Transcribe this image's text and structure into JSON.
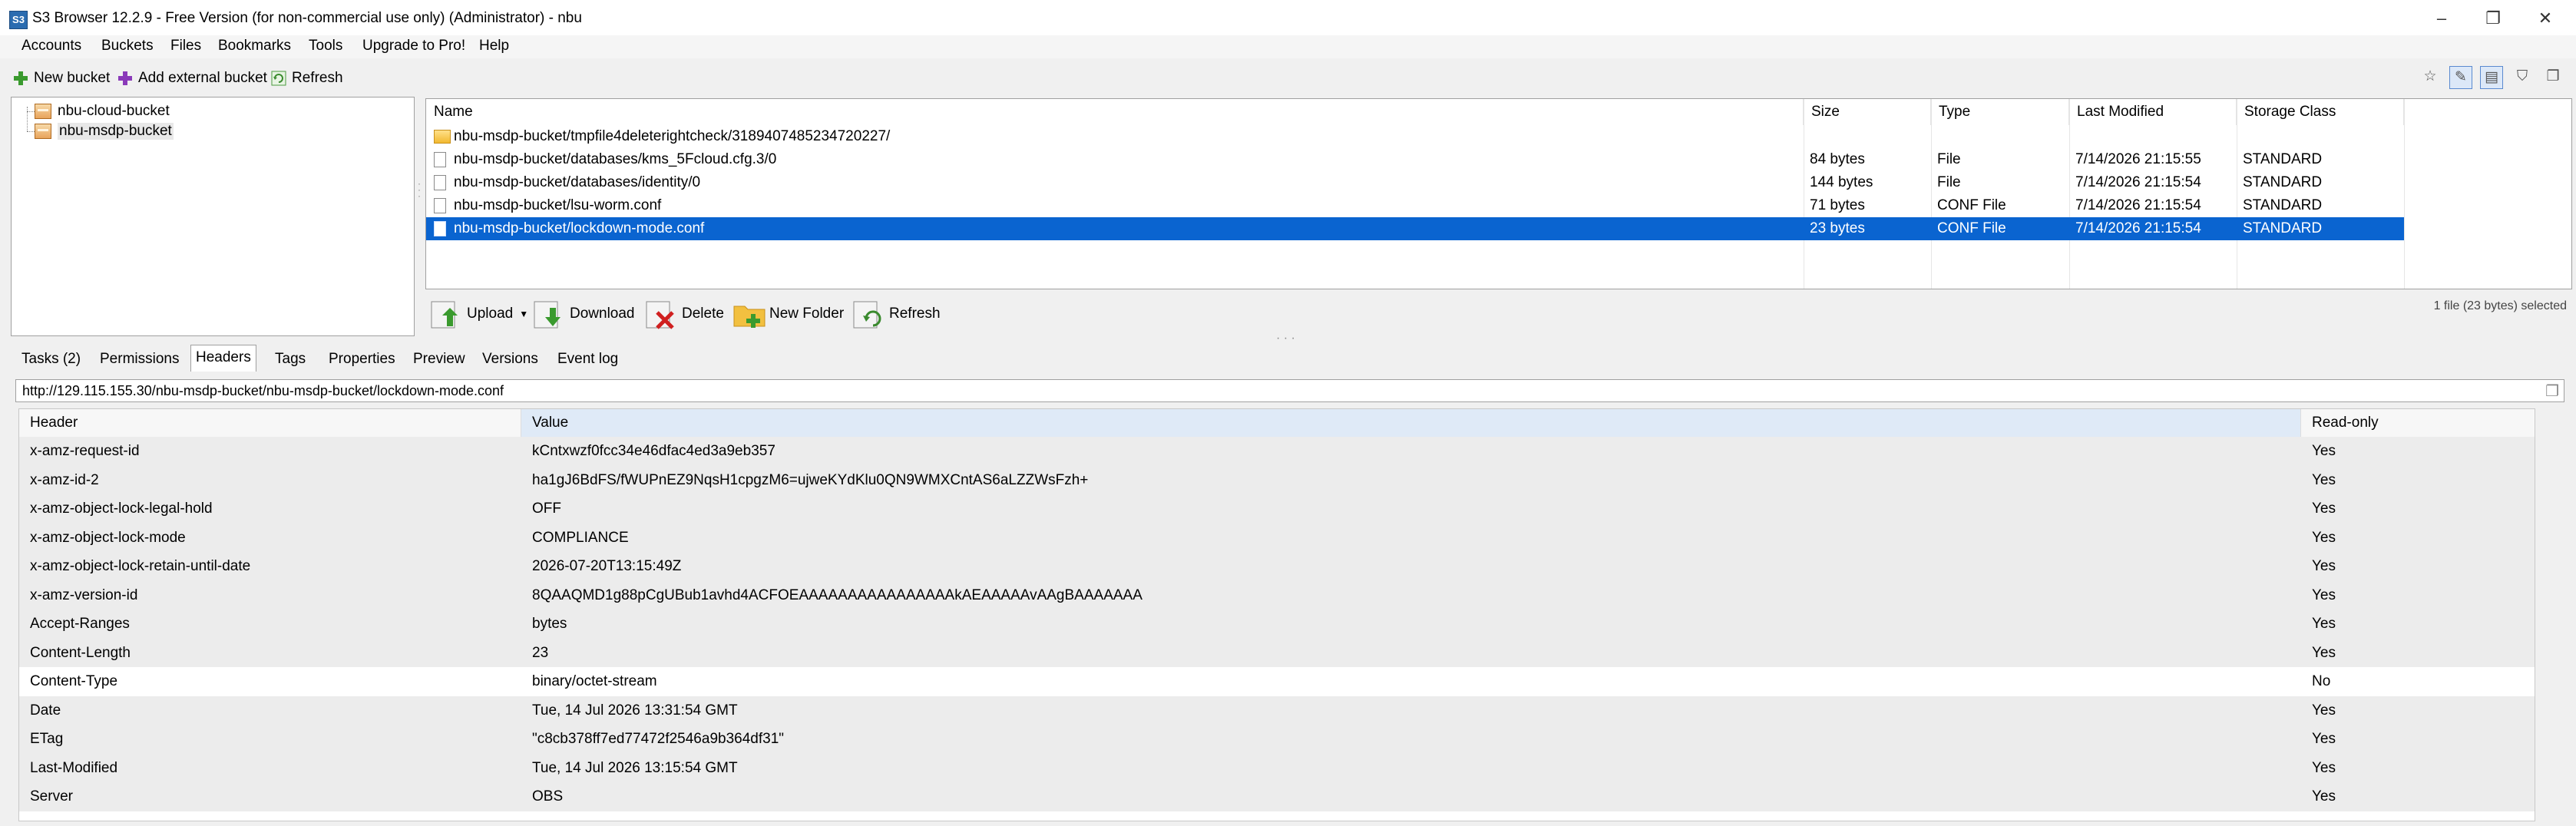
{
  "window": {
    "title": "S3 Browser 12.2.9 - Free Version (for non-commercial use only) (Administrator) - nbu",
    "app_icon": "s3-browser-icon",
    "minimize": "–",
    "maximize": "❐",
    "close": "✕"
  },
  "menu": [
    "Accounts",
    "Buckets",
    "Files",
    "Bookmarks",
    "Tools",
    "Upgrade to Pro!",
    "Help"
  ],
  "toolbar": {
    "new_bucket": "New bucket",
    "add_external_bucket": "Add external bucket",
    "refresh": "Refresh"
  },
  "buckets": [
    "nbu-cloud-bucket",
    "nbu-msdp-bucket"
  ],
  "file_list": {
    "columns": [
      "Name",
      "Size",
      "Type",
      "Last Modified",
      "Storage Class"
    ],
    "rows": [
      {
        "icon": "folder-icon",
        "name": "nbu-msdp-bucket/tmpfile4deleterightcheck/3189407485234720227/",
        "size": "",
        "type": "",
        "modified": "",
        "storage": ""
      },
      {
        "icon": "file-icon",
        "name": "nbu-msdp-bucket/databases/kms_5Fcloud.cfg.3/0",
        "size": "84 bytes",
        "type": "File",
        "modified": "7/14/2026 21:15:55",
        "storage": "STANDARD"
      },
      {
        "icon": "file-icon",
        "name": "nbu-msdp-bucket/databases/identity/0",
        "size": "144 bytes",
        "type": "File",
        "modified": "7/14/2026 21:15:54",
        "storage": "STANDARD"
      },
      {
        "icon": "file-icon",
        "name": "nbu-msdp-bucket/lsu-worm.conf",
        "size": "71 bytes",
        "type": "CONF File",
        "modified": "7/14/2026 21:15:54",
        "storage": "STANDARD"
      },
      {
        "icon": "file-icon",
        "name": "nbu-msdp-bucket/lockdown-mode.conf",
        "size": "23 bytes",
        "type": "CONF File",
        "modified": "7/14/2026 21:15:54",
        "storage": "STANDARD",
        "selected": true
      }
    ]
  },
  "actions": {
    "upload": "Upload",
    "download": "Download",
    "delete": "Delete",
    "new_folder": "New Folder",
    "refresh": "Refresh",
    "selection_status": "1 file (23 bytes) selected"
  },
  "tabs": [
    "Tasks (2)",
    "Permissions",
    "Headers",
    "Tags",
    "Properties",
    "Preview",
    "Versions",
    "Event log"
  ],
  "active_tab": "Headers",
  "url": "http://129.115.155.30/nbu-msdp-bucket/nbu-msdp-bucket/lockdown-mode.conf",
  "headers": {
    "columns": [
      "Header",
      "Value",
      "Read-only"
    ],
    "rows": [
      {
        "header": "x-amz-request-id",
        "value": "kCntxwzf0fcc34e46dfac4ed3a9eb357",
        "readonly": "Yes"
      },
      {
        "header": "x-amz-id-2",
        "value": "ha1gJ6BdFS/fWUPnEZ9NqsH1cpgzM6=ujweKYdKlu0QN9WMXCntAS6aLZZWsFzh+",
        "readonly": "Yes"
      },
      {
        "header": "x-amz-object-lock-legal-hold",
        "value": "OFF",
        "readonly": "Yes"
      },
      {
        "header": "x-amz-object-lock-mode",
        "value": "COMPLIANCE",
        "readonly": "Yes"
      },
      {
        "header": "x-amz-object-lock-retain-until-date",
        "value": "2026-07-20T13:15:49Z",
        "readonly": "Yes"
      },
      {
        "header": "x-amz-version-id",
        "value": "8QAAQMD1g88pCgUBub1avhd4ACFOEAAAAAAAAAAAAAAAAkAEAAAAAvAAgBAAAAAAA",
        "readonly": "Yes"
      },
      {
        "header": "Accept-Ranges",
        "value": "bytes",
        "readonly": "Yes"
      },
      {
        "header": "Content-Length",
        "value": "23",
        "readonly": "Yes"
      },
      {
        "header": "Content-Type",
        "value": "binary/octet-stream",
        "readonly": "No"
      },
      {
        "header": "Date",
        "value": "Tue, 14 Jul 2026 13:31:54 GMT",
        "readonly": "Yes"
      },
      {
        "header": "ETag",
        "value": "\"c8cb378ff7ed77472f2546a9b364df31\"",
        "readonly": "Yes"
      },
      {
        "header": "Last-Modified",
        "value": "Tue, 14 Jul 2026 13:15:54 GMT",
        "readonly": "Yes"
      },
      {
        "header": "Server",
        "value": "OBS",
        "readonly": "Yes"
      }
    ]
  },
  "colors": {
    "selection": "#0a64d0",
    "readonly_row": "#ececec",
    "editable_row": "#ffffff"
  }
}
